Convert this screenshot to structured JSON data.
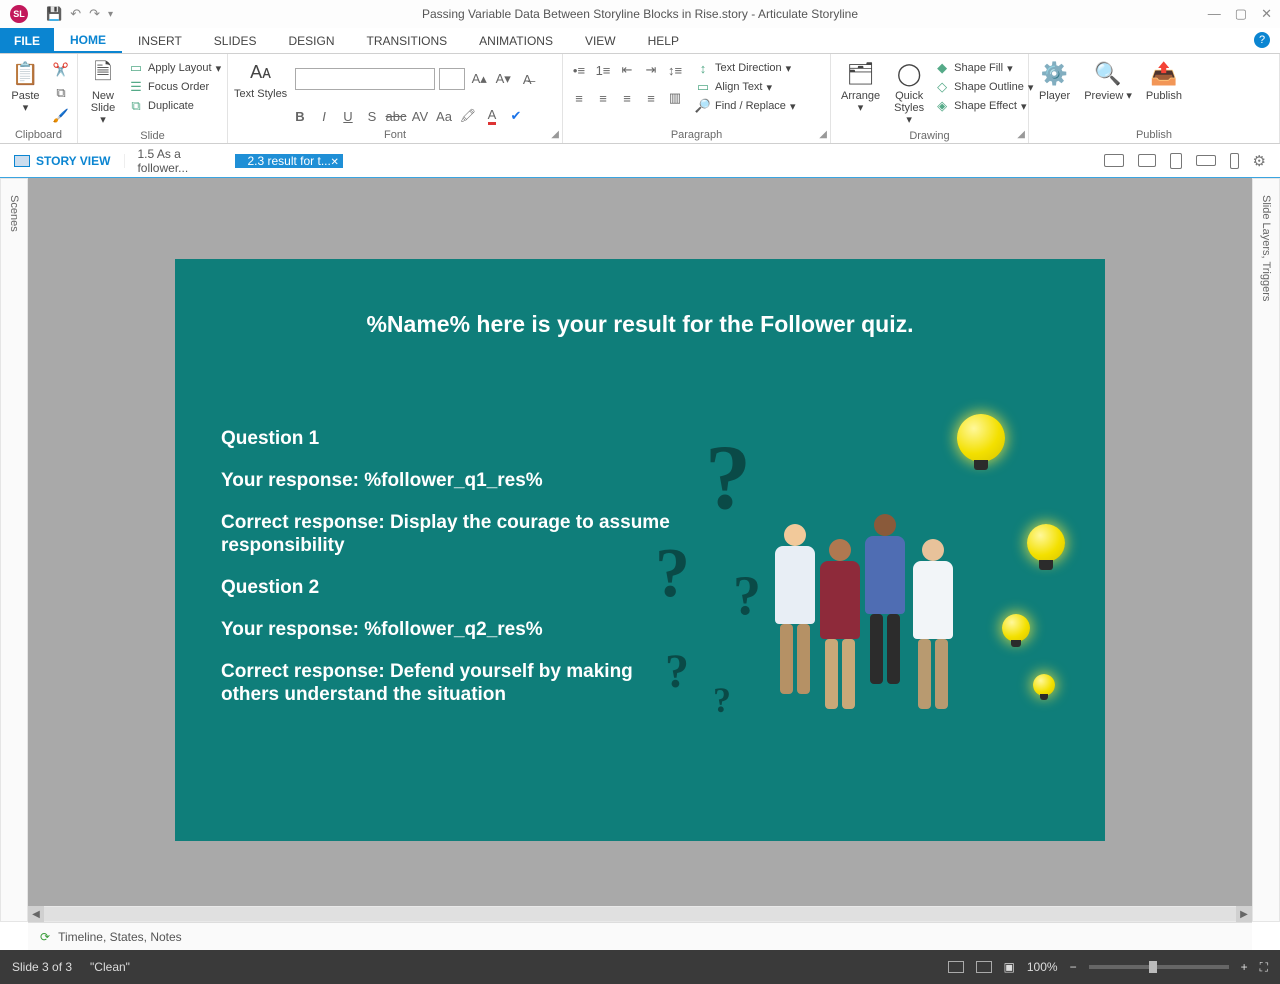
{
  "titlebar": {
    "app_badge": "SL",
    "document_title": "Passing Variable Data Between Storyline Blocks in Rise.story",
    "app_name": "Articulate Storyline"
  },
  "qat": {
    "save": "💾",
    "undo": "↶",
    "redo": "↷",
    "more": "▾"
  },
  "window_controls": {
    "min": "—",
    "max": "▢",
    "close": "✕"
  },
  "ribbon_tabs": {
    "file": "FILE",
    "items": [
      "HOME",
      "INSERT",
      "SLIDES",
      "DESIGN",
      "TRANSITIONS",
      "ANIMATIONS",
      "VIEW",
      "HELP"
    ],
    "active_index": 0
  },
  "ribbon": {
    "clipboard": {
      "paste": "Paste",
      "cut": "Cut",
      "copy": "Copy",
      "format_painter": "Format Painter",
      "label": "Clipboard"
    },
    "slide": {
      "new_slide": "New\nSlide",
      "apply_layout": "Apply Layout",
      "focus_order": "Focus Order",
      "duplicate": "Duplicate",
      "label": "Slide"
    },
    "font": {
      "text_styles": "Text Styles",
      "label": "Font"
    },
    "paragraph": {
      "text_direction": "Text Direction",
      "align_text": "Align Text",
      "find_replace": "Find / Replace",
      "label": "Paragraph"
    },
    "drawing": {
      "arrange": "Arrange",
      "quick_styles": "Quick\nStyles",
      "shape_fill": "Shape Fill",
      "shape_outline": "Shape Outline",
      "shape_effect": "Shape Effect",
      "label": "Drawing"
    },
    "publish": {
      "player": "Player",
      "preview": "Preview",
      "publish": "Publish",
      "label": "Publish"
    }
  },
  "docnav": {
    "story_view": "STORY VIEW",
    "tabs": [
      {
        "label": "1.5 As a follower...",
        "active": false
      },
      {
        "label": "2.3 result for t...",
        "active": true
      }
    ]
  },
  "rails": {
    "left": "Scenes",
    "right": "Slide Layers, Triggers"
  },
  "slide": {
    "title": "%Name% here is your result for the Follower quiz.",
    "q1_h": "Question 1",
    "q1_resp": "Your response: %follower_q1_res%",
    "q1_corr": "Correct response: Display the courage to assume responsibility",
    "q2_h": "Question 2",
    "q2_resp": "Your response: %follower_q2_res%",
    "q2_corr": "Correct response: Defend yourself by making others understand the situation"
  },
  "timeline": {
    "label": "Timeline, States, Notes"
  },
  "statusbar": {
    "slide_of": "Slide 3 of 3",
    "theme": "\"Clean\"",
    "zoom_pct": "100%",
    "zoom_minus": "−",
    "zoom_plus": "+"
  }
}
